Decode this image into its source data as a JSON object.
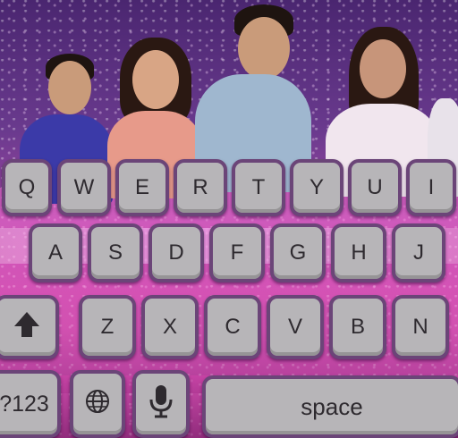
{
  "keyboard": {
    "row1": [
      "Q",
      "W",
      "E",
      "R",
      "T",
      "Y",
      "U",
      "I"
    ],
    "row2": [
      "A",
      "S",
      "D",
      "F",
      "G",
      "H",
      "J"
    ],
    "row3": [
      "Z",
      "X",
      "C",
      "V",
      "B",
      "N"
    ],
    "numbers_label": "?123",
    "space_label": "space",
    "shift_icon": "shift-arrow-icon",
    "globe_icon": "globe-icon",
    "mic_icon": "microphone-icon"
  },
  "colors": {
    "key_fill": "#b7b5b8",
    "key_border": "#6b4578",
    "key_text": "#2e2a2f",
    "background": "#b04aa8"
  }
}
